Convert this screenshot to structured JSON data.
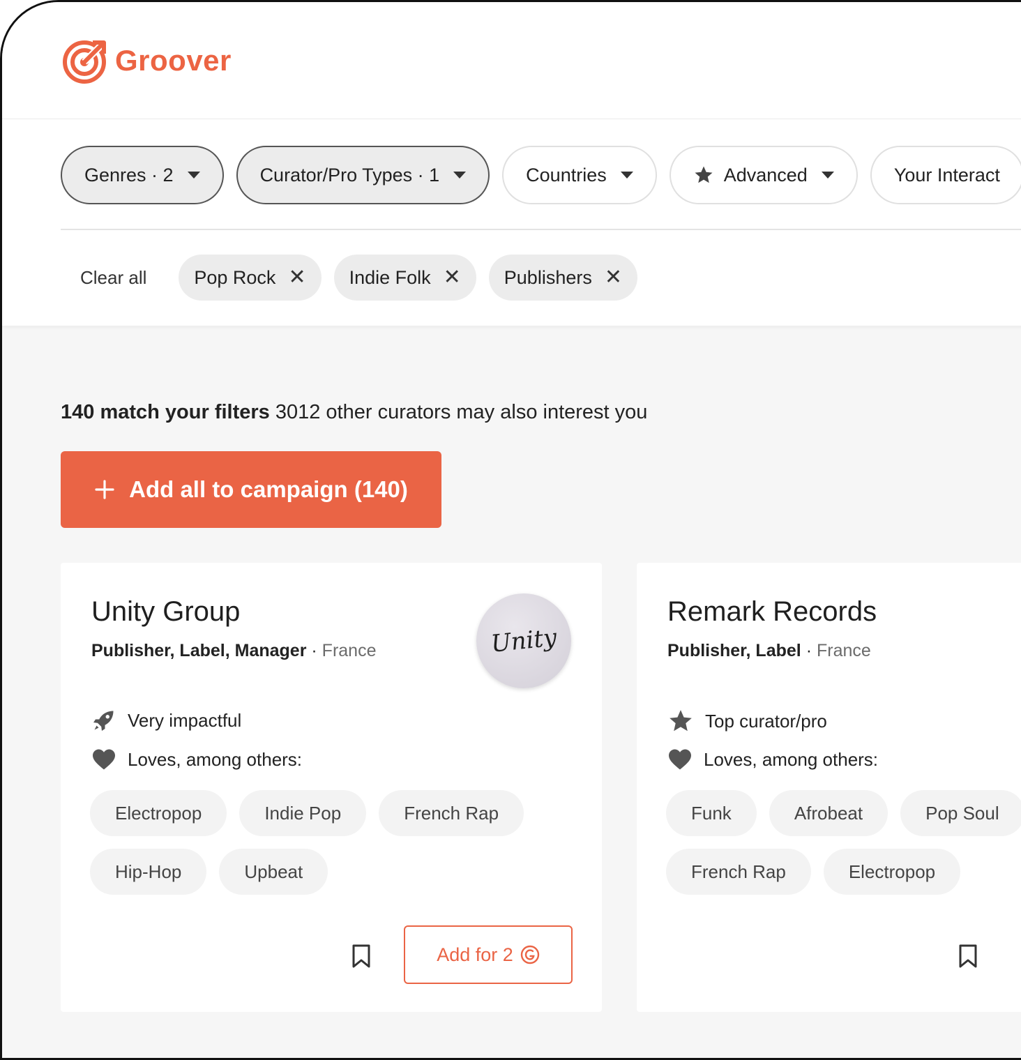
{
  "brand": {
    "name": "Groover",
    "accent_color": "#ea6445"
  },
  "filters": [
    {
      "label": "Genres · 2",
      "active": true,
      "icon": "caret-down-icon"
    },
    {
      "label": "Curator/Pro Types · 1",
      "active": true,
      "icon": "caret-down-icon"
    },
    {
      "label": "Countries",
      "active": false,
      "icon": "caret-down-icon"
    },
    {
      "label": "Advanced",
      "active": false,
      "leading_icon": "star-icon",
      "icon": "caret-down-icon"
    },
    {
      "label": "Your Interact",
      "active": false
    }
  ],
  "active_chips": {
    "clear_all_label": "Clear all",
    "chips": [
      "Pop Rock",
      "Indie Folk",
      "Publishers"
    ]
  },
  "results": {
    "match_text": "140 match your filters",
    "other_text": "3012 other curators may also interest you"
  },
  "add_all_button": {
    "label": "Add all to campaign (140)"
  },
  "cards": [
    {
      "name": "Unity Group",
      "roles": "Publisher, Label, Manager",
      "country": "France",
      "avatar_text": "Unity",
      "features": [
        {
          "icon": "rocket-icon",
          "text": "Very impactful"
        },
        {
          "icon": "heart-icon",
          "text": "Loves, among others:"
        }
      ],
      "tags": [
        "Electropop",
        "Indie Pop",
        "French Rap",
        "Hip-Hop",
        "Upbeat"
      ],
      "add_button_label": "Add for 2"
    },
    {
      "name": "Remark Records",
      "roles": "Publisher, Label",
      "country": "France",
      "features": [
        {
          "icon": "star-icon",
          "text": "Top curator/pro"
        },
        {
          "icon": "heart-icon",
          "text": "Loves, among others:"
        }
      ],
      "tags": [
        "Funk",
        "Afrobeat",
        "Pop Soul",
        "French Rap",
        "Electropop"
      ]
    }
  ]
}
